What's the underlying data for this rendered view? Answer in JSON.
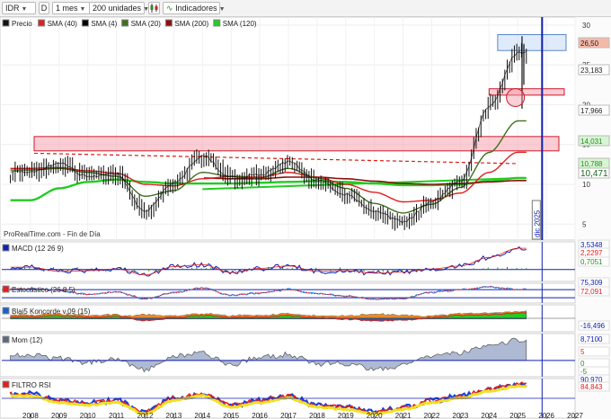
{
  "toolbar": {
    "symbol": "IDR",
    "d_button": "D",
    "period": "1 mes",
    "units": "200 unidades",
    "indicators": "Indicadores",
    "icons": [
      "chevron-down-icon",
      "candlestick-icon",
      "indicator-wave-icon"
    ]
  },
  "colors": {
    "price": "#111111",
    "sma40": "#e02020",
    "sma4": "#000000",
    "sma20": "#3f6f1f",
    "sma200": "#8b1010",
    "sma120": "#22cc22",
    "blue_line": "#1020b0",
    "zone_red": "#f59aa8",
    "zone_blue": "#b9d3f4"
  },
  "main_legend": [
    "Precio",
    "SMA (40)",
    "SMA (4)",
    "SMA (20)",
    "SMA (200)",
    "SMA (120)"
  ],
  "source_label": "ProRealTime.com - Fin de Día",
  "marker_label": "dic 2025",
  "right_tags": [
    "26,50",
    "23,183",
    "17,966",
    "14,031",
    "10,788",
    "10,471"
  ],
  "chart_data": [
    {
      "type": "line",
      "name": "price-panel",
      "x": [
        "2008",
        "2009",
        "2010",
        "2011",
        "2012",
        "2013",
        "2014",
        "2015",
        "2016",
        "2017",
        "2018",
        "2019",
        "2020",
        "2021",
        "2022",
        "2023",
        "2024",
        "2025",
        "2026",
        "2027"
      ],
      "y_ticks": [
        5,
        10,
        15,
        20,
        25,
        30
      ],
      "ylim": [
        3,
        31
      ],
      "series": [
        {
          "name": "Precio",
          "values": [
            11.5,
            12.6,
            11.0,
            11.3,
            6.6,
            10.2,
            13.6,
            10.8,
            11.2,
            12.8,
            10.5,
            8.8,
            6.5,
            5.3,
            7.8,
            10.4,
            19.8,
            26.5
          ]
        },
        {
          "name": "SMA (20)",
          "values": [
            11.8,
            12.0,
            11.5,
            11.0,
            8.5,
            9.2,
            11.5,
            11.0,
            10.8,
            12.0,
            10.8,
            9.5,
            7.6,
            6.4,
            7.5,
            9.6,
            14.0,
            17.966
          ]
        },
        {
          "name": "SMA (40)",
          "values": [
            12.0,
            12.1,
            11.7,
            11.4,
            10.0,
            9.8,
            10.7,
            11.0,
            10.9,
            11.5,
            10.9,
            10.0,
            9.0,
            7.8,
            8.0,
            8.9,
            11.5,
            14.031
          ]
        },
        {
          "name": "SMA (120)",
          "values": [
            8.0,
            9.5,
            10.3,
            10.6,
            10.3,
            10.1,
            10.1,
            10.1,
            10.2,
            10.3,
            10.4,
            10.3,
            10.1,
            9.9,
            9.9,
            10.0,
            10.4,
            10.788
          ]
        },
        {
          "name": "SMA (200)",
          "values": [
            null,
            null,
            null,
            null,
            null,
            null,
            10.8,
            10.7,
            10.7,
            10.9,
            10.9,
            10.7,
            10.4,
            10.1,
            10.0,
            10.1,
            10.3,
            10.471
          ]
        }
      ],
      "resistance_dashed": {
        "start_value": 13.9,
        "end_value": 12.6
      },
      "support_line": {
        "start_value": 9.4,
        "end_value": 10.8
      },
      "zones": [
        {
          "from": 14.2,
          "to": 16.0
        },
        {
          "from": 21.2,
          "to": 22.0
        },
        {
          "from": 26.8,
          "to": 28.8
        }
      ]
    },
    {
      "type": "line",
      "name": "MACD (12 26 9)",
      "tags": [
        "3,5348",
        "2,2297",
        "0,7051"
      ],
      "series": [
        {
          "name": "MACD",
          "values": [
            0.4,
            -0.3,
            -0.2,
            0.1,
            -0.9,
            0.5,
            0.8,
            -0.5,
            0.2,
            0.6,
            -0.3,
            -0.2,
            -0.6,
            -0.4,
            0.1,
            0.6,
            2.0,
            3.5
          ]
        }
      ]
    },
    {
      "type": "line",
      "name": "Estocástico (26 8 5)",
      "tags": [
        "75,309",
        "72,091"
      ],
      "series": [
        {
          "name": "Estocástico",
          "values": [
            80,
            70,
            45,
            60,
            20,
            55,
            85,
            40,
            55,
            75,
            50,
            35,
            15,
            20,
            60,
            75,
            92,
            75
          ]
        }
      ]
    },
    {
      "type": "area",
      "name": "Blai5 Koncorde v.09 (15)",
      "tags": [
        "-16,496"
      ],
      "series": [
        {
          "name": "Koncorde",
          "values": [
            5,
            8,
            4,
            6,
            -6,
            2,
            9,
            3,
            4,
            8,
            2,
            -2,
            -8,
            -5,
            3,
            9,
            12,
            16
          ]
        }
      ]
    },
    {
      "type": "area",
      "name": "Mom (12)",
      "tags": [
        "8,7100",
        "5",
        "0",
        "-5"
      ],
      "series": [
        {
          "name": "Mom",
          "values": [
            2.5,
            0.8,
            -0.8,
            0.8,
            -4.2,
            1.8,
            3.2,
            -1.8,
            1.2,
            2.6,
            -1.5,
            -1.3,
            -3.8,
            -2.2,
            1.8,
            3.2,
            5.8,
            8.71
          ]
        }
      ]
    },
    {
      "type": "line",
      "name": "FILTRO RSI",
      "tags": [
        "90,970",
        "84,843"
      ],
      "series": [
        {
          "name": "FILTRO RSI",
          "values": [
            70,
            55,
            50,
            55,
            30,
            60,
            70,
            45,
            55,
            65,
            45,
            40,
            30,
            40,
            55,
            65,
            80,
            91
          ]
        }
      ]
    }
  ]
}
